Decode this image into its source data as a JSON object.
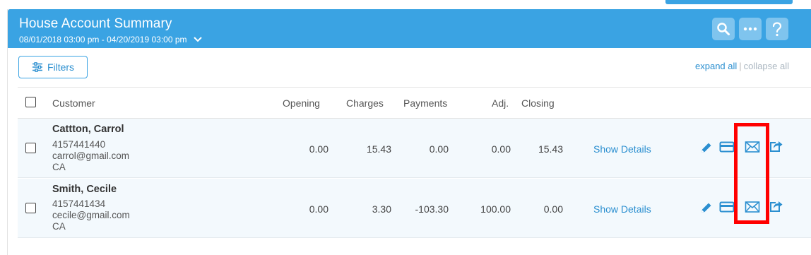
{
  "header": {
    "title": "House Account Summary",
    "date_range": "08/01/2018 03:00 pm - 04/20/2019 03:00 pm"
  },
  "toolbar": {
    "filters_label": "Filters",
    "expand_all": "expand all",
    "separator": "|",
    "collapse_all": "collapse all"
  },
  "table": {
    "columns": {
      "customer": "Customer",
      "opening": "Opening",
      "charges": "Charges",
      "payments": "Payments",
      "adj": "Adj.",
      "closing": "Closing"
    },
    "rows": [
      {
        "name": "Cattton, Carrol",
        "phone": "4157441440",
        "email": "carrol@gmail.com",
        "state": "CA",
        "opening": "0.00",
        "charges": "15.43",
        "payments": "0.00",
        "adj": "0.00",
        "closing": "15.43",
        "details_label": "Show Details"
      },
      {
        "name": "Smith, Cecile",
        "phone": "4157441434",
        "email": "cecile@gmail.com",
        "state": "CA",
        "opening": "0.00",
        "charges": "3.30",
        "payments": "-103.30",
        "adj": "100.00",
        "closing": "0.00",
        "details_label": "Show Details"
      }
    ]
  },
  "icons": [
    "search-icon",
    "more-icon",
    "help-icon",
    "filters-icon",
    "edit-icon",
    "card-icon",
    "email-icon",
    "export-icon"
  ],
  "colors": {
    "header_bg": "#3aa3e3",
    "accent": "#2b8fd0",
    "row_bg": "#f3f9fd",
    "highlight": "#ff0000"
  }
}
